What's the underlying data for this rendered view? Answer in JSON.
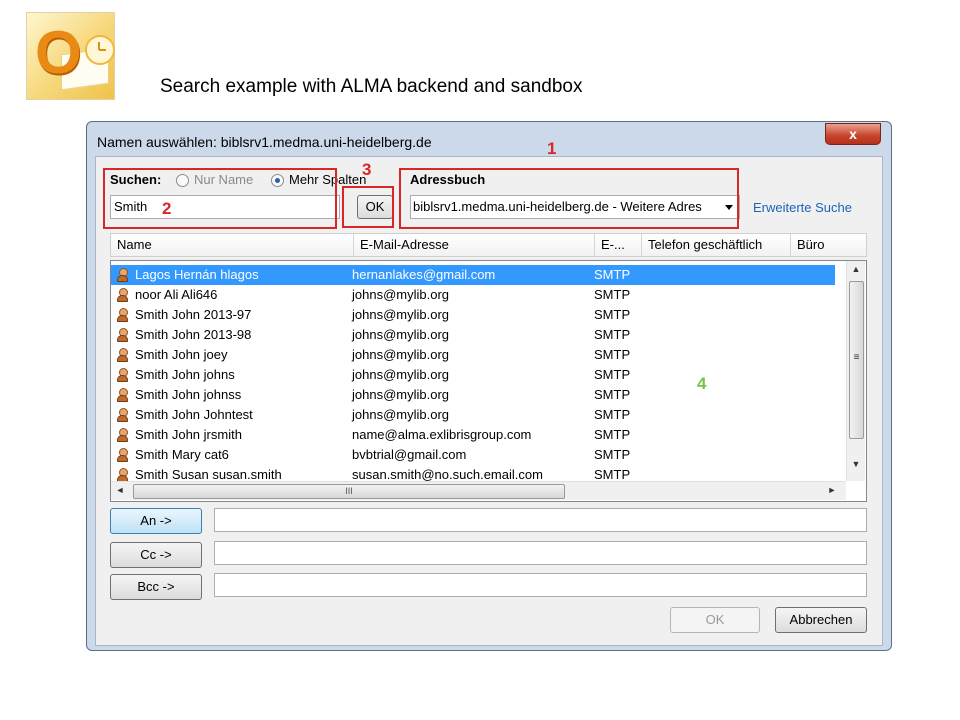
{
  "slide": {
    "title": "Search example with ALMA backend and sandbox"
  },
  "dialog": {
    "title": "Namen auswählen: biblsrv1.medma.uni-heidelberg.de",
    "close_glyph": "x",
    "search": {
      "label": "Suchen:",
      "radio_name_only": "Nur Name",
      "radio_more_columns": "Mehr Spalten",
      "value": "Smith",
      "ok_label": "OK"
    },
    "addressbook": {
      "label": "Adressbuch",
      "selected": "biblsrv1.medma.uni-heidelberg.de - Weitere Adres",
      "advanced_link": "Erweiterte Suche"
    },
    "columns": [
      "Name",
      "E-Mail-Adresse",
      "E-...",
      "Telefon geschäftlich",
      "Büro"
    ],
    "rows": [
      {
        "name": "Lagos Hernán hlagos",
        "email": "hernanlakes@gmail.com",
        "type": "SMTP",
        "selected": true
      },
      {
        "name": "noor Ali Ali646",
        "email": "johns@mylib.org",
        "type": "SMTP"
      },
      {
        "name": "Smith John 2013-97",
        "email": "johns@mylib.org",
        "type": "SMTP"
      },
      {
        "name": "Smith John 2013-98",
        "email": "johns@mylib.org",
        "type": "SMTP"
      },
      {
        "name": "Smith John joey",
        "email": "johns@mylib.org",
        "type": "SMTP"
      },
      {
        "name": "Smith John johns",
        "email": "johns@mylib.org",
        "type": "SMTP"
      },
      {
        "name": "Smith John johnss",
        "email": "johns@mylib.org",
        "type": "SMTP"
      },
      {
        "name": "Smith John Johntest",
        "email": "johns@mylib.org",
        "type": "SMTP"
      },
      {
        "name": "Smith John jrsmith",
        "email": "name@alma.exlibrisgroup.com",
        "type": "SMTP"
      },
      {
        "name": "Smith Mary cat6",
        "email": "bvbtrial@gmail.com",
        "type": "SMTP"
      },
      {
        "name": "Smith Susan susan.smith",
        "email": "susan.smith@no.such.email.com",
        "type": "SMTP"
      }
    ],
    "recipients": {
      "to_label": "An ->",
      "cc_label": "Cc ->",
      "bcc_label": "Bcc ->"
    },
    "footer": {
      "ok_label": "OK",
      "cancel_label": "Abbrechen"
    }
  },
  "annotations": {
    "n1": "1",
    "n2": "2",
    "n3": "3",
    "n4": "4"
  },
  "icons": {
    "dropdown": "dropdown-arrow-icon",
    "scroll_up": "▲",
    "scroll_down": "▼",
    "scroll_left": "◄",
    "scroll_right": "►",
    "scroll_grip_v": "≡",
    "scroll_grip_h": "III"
  },
  "colors": {
    "annotation_red": "#d62828",
    "annotation_green": "#78c04a",
    "selection": "#3399ff",
    "link": "#1a64b6"
  }
}
